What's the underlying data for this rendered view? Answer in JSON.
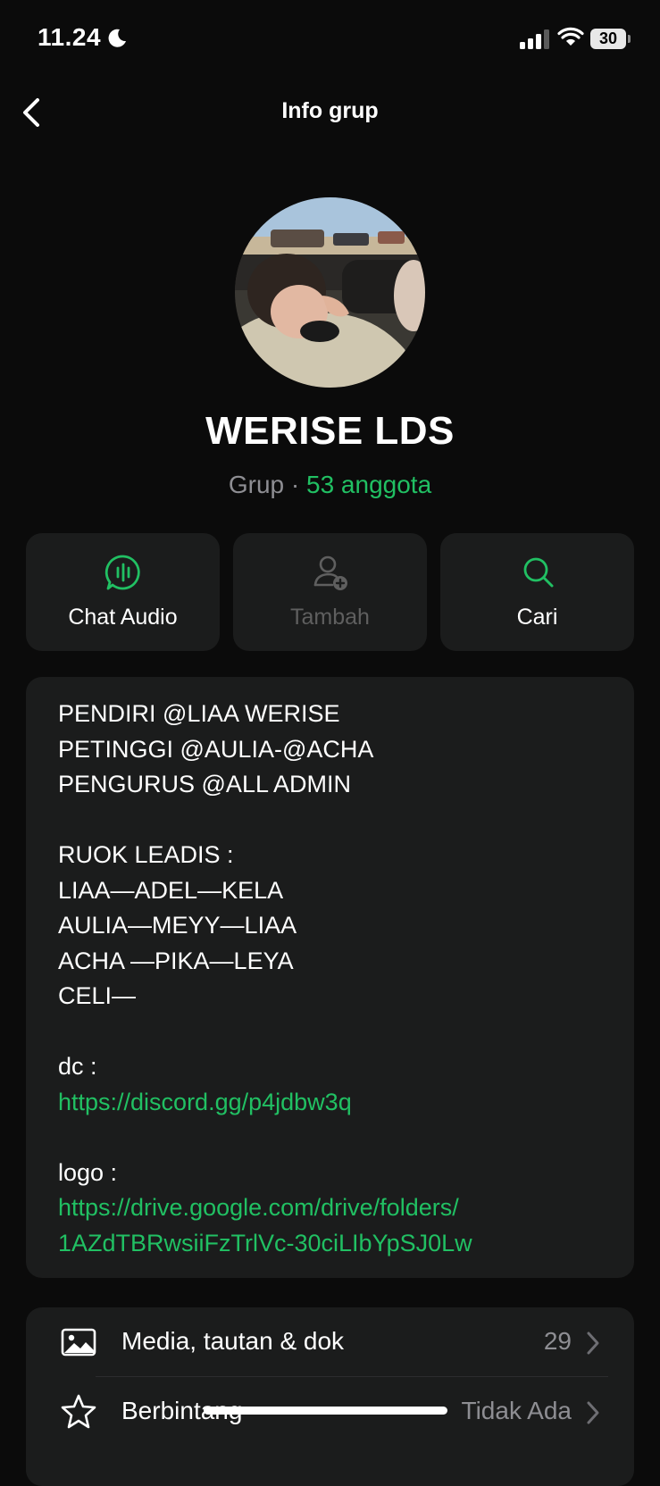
{
  "status_bar": {
    "time": "11.24",
    "battery": "30"
  },
  "nav": {
    "title": "Info grup",
    "back_icon": "chevron-left-icon"
  },
  "group": {
    "name": "WERISE LDS",
    "type": "Grup",
    "separator": " · ",
    "members": "53 anggota"
  },
  "actions": [
    {
      "label": "Chat Audio",
      "icon": "audio-chat-icon",
      "enabled": true
    },
    {
      "label": "Tambah",
      "icon": "add-person-icon",
      "enabled": false
    },
    {
      "label": "Cari",
      "icon": "search-icon",
      "enabled": true
    }
  ],
  "description": {
    "lines": [
      "PENDIRI @LIAA WERISE",
      "PETINGGI @AULIA-@ACHA",
      "PENGURUS @ALL ADMIN",
      "",
      "RUOK LEADIS :",
      "LIAA—ADEL—KELA",
      "AULIA—MEYY—LIAA",
      "ACHA —PIKA—LEYA",
      "CELI—",
      "",
      "dc :",
      "https://discord.gg/p4jdbw3q",
      "",
      "logo :",
      "https://drive.google.com/drive/folders/",
      "1AZdTBRwsiiFzTrlVc-30ciLIbYpSJ0Lw"
    ]
  },
  "menu": [
    {
      "label": "Media, tautan & dok",
      "value": "29",
      "icon": "image-icon"
    },
    {
      "label": "Berbintang",
      "value": "Tidak Ada",
      "icon": "star-icon"
    }
  ],
  "colors": {
    "accent": "#21c063",
    "card": "#1b1c1c",
    "background": "#0b0b0b",
    "muted": "#8e8e93"
  }
}
